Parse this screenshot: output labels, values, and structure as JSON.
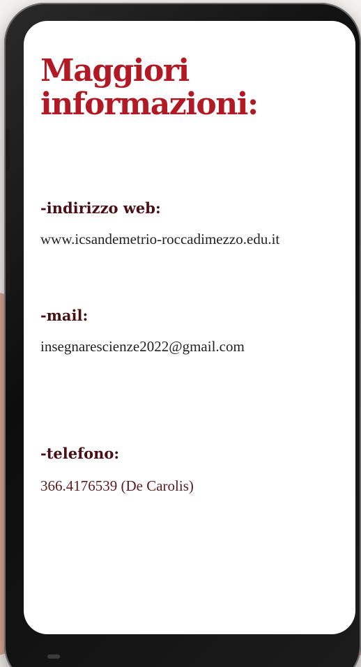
{
  "title": {
    "line1": "Maggiori",
    "line2": "informazioni:"
  },
  "contacts": [
    {
      "label": "-indirizzo web:",
      "value": "www.icsandemetrio-roccadimezzo.edu.it"
    },
    {
      "label": "-mail:",
      "value": "insegnarescienze2022@gmail.com"
    },
    {
      "label": "-telefono:",
      "value": "366.4176539 (De Carolis)"
    }
  ],
  "colors": {
    "title": "#b11a24",
    "label": "#4a0f14",
    "text": "#222222",
    "phone_frame": "#111111",
    "screen": "#ffffff"
  }
}
